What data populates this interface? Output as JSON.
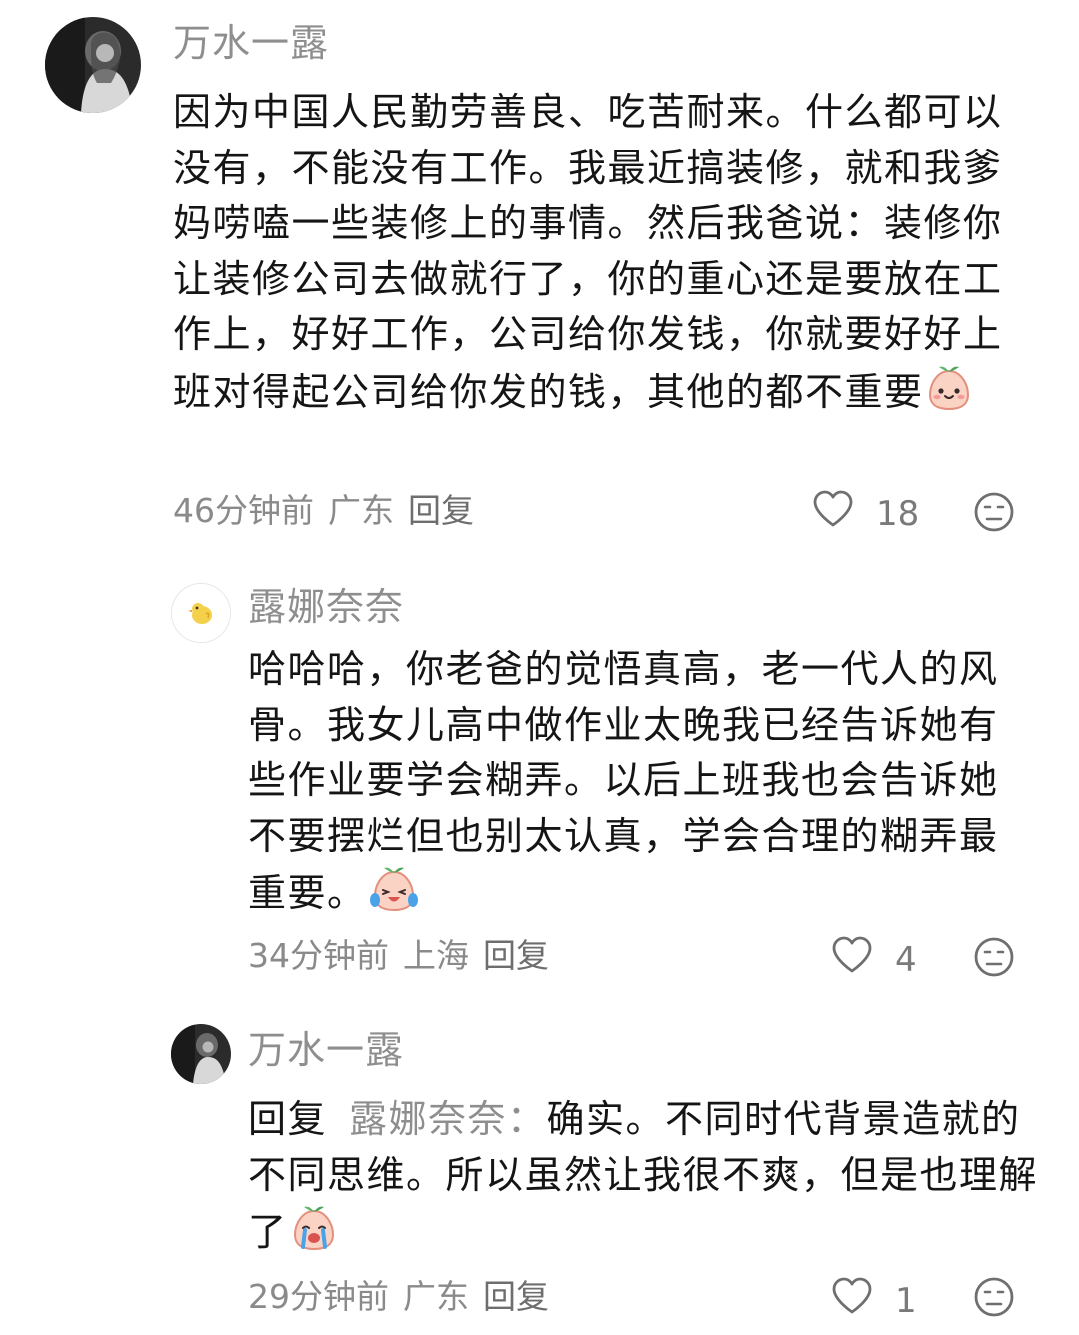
{
  "comments": [
    {
      "nickname": "万水一露",
      "text": "因为中国人民勤劳善良、吃苦耐来。什么都可以没有，不能没有工作。我最近搞装修，就和我爹妈唠嗑一些装修上的事情。然后我爸说：装修你让装修公司去做就行了，你的重心还是要放在工作上，好好工作，公司给你发钱，你就要好好上班对得起公司给你发的钱，其他的都不重要",
      "emoji": "smile-emoji-icon",
      "time": "46分钟前",
      "location": "广东",
      "reply_label": "回复",
      "likes": "18"
    },
    {
      "nickname": "露娜奈奈",
      "text": "哈哈哈，你老爸的觉悟真高，老一代人的风骨。我女儿高中做作业太晚我已经告诉她有些作业要学会糊弄。以后上班我也会告诉她不要摆烂但也别太认真，学会合理的糊弄最重要。",
      "emoji": "laugh-cry-emoji-icon",
      "time": "34分钟前",
      "location": "上海",
      "reply_label": "回复",
      "likes": "4"
    },
    {
      "nickname": "万水一露",
      "reply_prefix": "回复",
      "reply_target": "露娜奈奈：",
      "text": "确实。不同时代背景造就的不同思维。所以虽然让我很不爽，但是也理解了",
      "emoji": "crying-emoji-icon",
      "time": "29分钟前",
      "location": "广东",
      "reply_label": "回复",
      "likes": "1"
    }
  ]
}
